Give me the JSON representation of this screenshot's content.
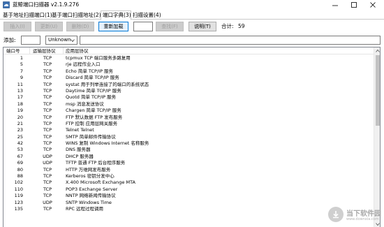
{
  "window": {
    "title": "蓝鲸端口扫描器 v2.1.9.276"
  },
  "tabs": [
    {
      "label": "基于地址扫描端口(1)",
      "active": false
    },
    {
      "label": "基于端口扫描地址(2)",
      "active": false
    },
    {
      "label": "端口字典(3)",
      "active": true
    },
    {
      "label": "扫描设置(4)",
      "active": false
    }
  ],
  "toolbar": {
    "insert_label": "插入(I)",
    "update_label": "更新(U)",
    "delete_label": "删除(D)",
    "reload_label": "重新加载",
    "search_value": "",
    "find_label": "查找(F)",
    "help_label": "说明(T)",
    "total_label": "合计:",
    "total_value": "59"
  },
  "add_row": {
    "add_label": "添加:",
    "port_value": "",
    "protocol_value": "Unknown",
    "app_value": ""
  },
  "table": {
    "headers": [
      "端口号",
      "运输层协议",
      "应用层协议"
    ],
    "rows": [
      [
        "1",
        "TCP",
        "tcpmux TCP 端口服务多路复用"
      ],
      [
        "5",
        "TCP",
        "rje 远程作业入口"
      ],
      [
        "7",
        "TCP",
        "Echo 简单 TCP/IP 服务"
      ],
      [
        "9",
        "TCP",
        "Discard 简单 TCP/IP 服务"
      ],
      [
        "11",
        "TCP",
        "systat 用于列举连接了的端口的系统状态"
      ],
      [
        "13",
        "TCP",
        "Daytime 简单 TCP/IP 服务"
      ],
      [
        "17",
        "TCP",
        "Quotd 简单 TCP/IP 服务"
      ],
      [
        "18",
        "TCP",
        "msp 消息发送协议"
      ],
      [
        "19",
        "TCP",
        "Chargen 简单 TCP/IP 服务"
      ],
      [
        "20",
        "TCP",
        "FTP 默认数据 FTP 发布服务"
      ],
      [
        "21",
        "TCP",
        "FTP 控制 应用层网关服务"
      ],
      [
        "23",
        "TCP",
        "Telnet Telnet"
      ],
      [
        "25",
        "TCP",
        "SMTP 简单邮件传输协议"
      ],
      [
        "42",
        "TCP",
        "WINS 复制 Windows Internet 名称服务"
      ],
      [
        "53",
        "TCP",
        "DNS 服务器"
      ],
      [
        "67",
        "UDP",
        "DHCP 服务器"
      ],
      [
        "69",
        "UDP",
        "TFTP 普通 FTP 后台程序服务"
      ],
      [
        "80",
        "TCP",
        "HTTP 万维网发布服务"
      ],
      [
        "88",
        "TCP",
        "Kerberos 密钥分发中心"
      ],
      [
        "102",
        "TCP",
        "X.400 Microsoft Exchange MTA"
      ],
      [
        "110",
        "TCP",
        "POP3 Exchange Server"
      ],
      [
        "119",
        "TCP",
        "NNTP 网络新闻传输协议"
      ],
      [
        "123",
        "UDP",
        "SNTP Windows Time"
      ],
      [
        "135",
        "TCP",
        "RPC 远程过程调用"
      ]
    ]
  },
  "watermark": {
    "title": "当下软件园",
    "subtitle": "www.downxia.com"
  },
  "colors": {
    "accent": "#0078d7",
    "button_face": "#e1e1e1",
    "disabled_text": "#a0a0a0",
    "border": "#adadad"
  },
  "icons": {
    "app": "whale-logo-icon",
    "minimize": "minimize-icon",
    "maximize": "maximize-icon",
    "close": "close-icon",
    "dropdown": "chevron-down-icon",
    "scroll_up": "scroll-up-arrow-icon",
    "scroll_down": "scroll-down-arrow-icon"
  }
}
